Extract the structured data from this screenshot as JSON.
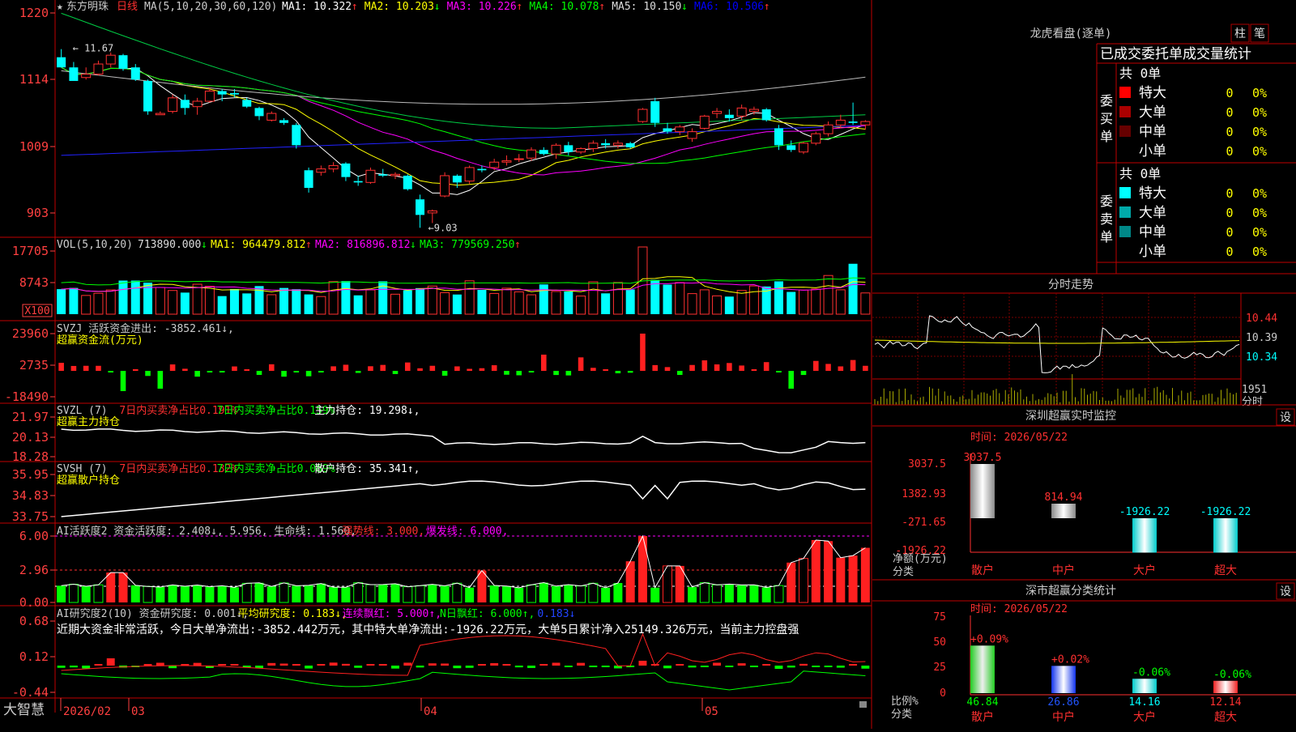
{
  "stock_name": "东方明珠",
  "period_label": "日线",
  "brand": "大智慧",
  "panels": {
    "main": {
      "ma_title": "MA(5,10,20,30,60,120)",
      "indicators": [
        {
          "label": "MA1: 10.322",
          "arrow": "↑",
          "color": "#ffffff"
        },
        {
          "label": "MA2: 10.203",
          "arrow": "↓",
          "color": "#ffff00"
        },
        {
          "label": "MA3: 10.226",
          "arrow": "↑",
          "color": "#ff00ff"
        },
        {
          "label": "MA4: 10.078",
          "arrow": "↑",
          "color": "#00ff00"
        },
        {
          "label": "MA5: 10.150",
          "arrow": "↓",
          "color": "#dddddd"
        },
        {
          "label": "MA6: 10.506",
          "arrow": "↑",
          "color": "#0000ff"
        }
      ],
      "y_labels": [
        "1220",
        "1114",
        "1009",
        "903"
      ],
      "high_mark": "11.67",
      "low_mark": "9.03"
    },
    "vol": {
      "title": "VOL(5,10,20)",
      "indicators": [
        {
          "label": "713890.000",
          "arrow": "↓",
          "color": "#dddddd"
        },
        {
          "label": "MA1: 964479.812",
          "arrow": "↑",
          "color": "#ffff00"
        },
        {
          "label": "MA2: 816896.812",
          "arrow": "↓",
          "color": "#ff00ff"
        },
        {
          "label": "MA3: 779569.250",
          "arrow": "↑",
          "color": "#00ff00"
        }
      ],
      "y_labels": [
        "17705",
        "8743",
        "X100"
      ]
    },
    "svzj": {
      "title": "SVZJ  活跃资金进出: -3852.461↓,",
      "subtitle": "超赢资金流(万元)",
      "y_labels": [
        "23960",
        "2735",
        "-18490"
      ]
    },
    "svzl": {
      "title_parts": [
        "SVZL (7) ",
        "7日内买卖净占比0.191%",
        "7日内买卖净占比0.159%",
        " 主力持仓: 19.298↓,"
      ],
      "subtitle": "超赢主力持仓",
      "y_labels": [
        "21.97",
        "20.13",
        "18.28"
      ]
    },
    "svsh": {
      "title_parts": [
        "SVSH (7) ",
        "7日内买卖净占比0.132%",
        "7日内买卖净占比0.089%",
        " 散户持仓: 35.341↑,"
      ],
      "subtitle": "超赢散户持仓",
      "y_labels": [
        "35.95",
        "34.83",
        "33.75"
      ]
    },
    "ai1": {
      "title_parts": [
        "AI活跃度2 资金活跃度: 2.408↓, 5.956, 生命线: 1.560, ",
        "强势线: 3.000, ",
        "爆发线: 6.000,"
      ],
      "y_labels": [
        "6.00",
        "2.96",
        "0.00"
      ]
    },
    "ai2": {
      "title_parts": [
        "AI研究度2(10) 资金研究度: 0.001↓, ",
        "平均研究度: 0.183↓, ",
        "连续飘红: 5.000↑, ",
        "N日飘红: 6.000↑, ",
        "0.183↓"
      ],
      "note": "近期大资金非常活跃，今日大单净流出:-3852.442万元，其中特大单净流出:-1926.22万元，大单5日累计净入25149.326万元，当前主力控盘强",
      "y_labels": [
        "0.68",
        "0.12",
        "-0.44"
      ]
    }
  },
  "date_axis": [
    "2026/02",
    "03",
    "04",
    "05"
  ],
  "right": {
    "dragon_title": "龙虎看盘(逐单)",
    "tab_zhu": "柱",
    "tab_bi": "笔",
    "stats_header": "已成交委托单成交量统计",
    "buy": {
      "side_label": "委买单",
      "count": "共 0单",
      "rows": [
        {
          "label": "特大",
          "val": "0",
          "pct": "0%",
          "color": "#ff0000"
        },
        {
          "label": "大单",
          "val": "0",
          "pct": "0%",
          "color": "#aa0000"
        },
        {
          "label": "中单",
          "val": "0",
          "pct": "0%",
          "color": "#660000"
        },
        {
          "label": "小单",
          "val": "0",
          "pct": "0%",
          "color": ""
        }
      ]
    },
    "sell": {
      "side_label": "委卖单",
      "count": "共 0单",
      "rows": [
        {
          "label": "特大",
          "val": "0",
          "pct": "0%",
          "color": "#00ffff"
        },
        {
          "label": "大单",
          "val": "0",
          "pct": "0%",
          "color": "#00aaaa"
        },
        {
          "label": "中单",
          "val": "0",
          "pct": "0%",
          "color": "#008888"
        },
        {
          "label": "小单",
          "val": "0",
          "pct": "0%",
          "color": ""
        }
      ]
    },
    "intraday": {
      "title": "分时走势",
      "labels": [
        "10.44",
        "10.39",
        "10.34"
      ],
      "vol_label": "1951",
      "vol_caption": "分时"
    },
    "monitor": {
      "title": "深圳超赢实时监控",
      "setting": "设",
      "time": "时间: 2026/05/22",
      "y_labels": [
        "3037.5",
        "1382.93",
        "-271.65",
        "-1926.22"
      ],
      "axis_caption_1": "净额(万元)",
      "axis_caption_2": "分类",
      "categories": [
        "散户",
        "中户",
        "大户",
        "超大"
      ],
      "values": [
        3037.5,
        814.94,
        -1926.22,
        -1926.22
      ],
      "value_labels": [
        "3037.5",
        "814.94",
        "-1926.22",
        "-1926.22"
      ]
    },
    "classify": {
      "title": "深市超赢分类统计",
      "setting": "设",
      "time": "时间: 2026/05/22",
      "y_labels": [
        "75",
        "50",
        "25",
        "0"
      ],
      "axis_caption_1": "比例%",
      "axis_caption_2": "分类",
      "categories": [
        "散户",
        "中户",
        "大户",
        "超大"
      ],
      "values": [
        46.84,
        26.86,
        14.16,
        12.14
      ],
      "changes": [
        "+0.09%",
        "+0.02%",
        "-0.06%",
        "-0.06%"
      ]
    }
  },
  "chart_data": [
    {
      "type": "candlestick",
      "title": "东方明珠 日线",
      "ylim": [
        9.03,
        12.2
      ],
      "x": [
        "2026/02",
        "03",
        "04",
        "05"
      ],
      "series": [
        {
          "name": "MA1",
          "values": []
        },
        {
          "name": "MA2",
          "values": []
        },
        {
          "name": "MA3",
          "values": []
        },
        {
          "name": "MA4",
          "values": []
        },
        {
          "name": "MA5",
          "values": []
        },
        {
          "name": "MA6",
          "values": []
        }
      ],
      "candles": [
        [
          11.55,
          11.67,
          11.45,
          11.4
        ],
        [
          11.4,
          11.48,
          11.22,
          11.2
        ],
        [
          11.25,
          11.4,
          11.22,
          11.3
        ],
        [
          11.3,
          11.5,
          11.28,
          11.45
        ],
        [
          11.45,
          11.62,
          11.4,
          11.58
        ],
        [
          11.58,
          11.6,
          11.35,
          11.38
        ],
        [
          11.4,
          11.45,
          11.2,
          11.22
        ],
        [
          11.2,
          11.22,
          10.7,
          10.75
        ],
        [
          10.7,
          10.75,
          10.7,
          10.72
        ],
        [
          10.75,
          11.0,
          10.72,
          10.95
        ],
        [
          10.92,
          11.0,
          10.7,
          10.8
        ],
        [
          10.82,
          10.95,
          10.7,
          10.9
        ],
        [
          10.9,
          11.1,
          10.88,
          11.05
        ],
        [
          11.05,
          11.08,
          10.9,
          11.0
        ],
        [
          11.02,
          11.08,
          10.96,
          11.0
        ],
        [
          10.92,
          10.95,
          10.8,
          10.82
        ],
        [
          10.8,
          10.82,
          10.62,
          10.68
        ],
        [
          10.62,
          10.75,
          10.6,
          10.72
        ],
        [
          10.62,
          10.65,
          10.55,
          10.58
        ],
        [
          10.55,
          10.58,
          10.2,
          10.25
        ],
        [
          9.88,
          9.92,
          9.55,
          9.62
        ],
        [
          9.85,
          9.95,
          9.8,
          9.9
        ],
        [
          9.9,
          10.0,
          9.85,
          9.95
        ],
        [
          9.98,
          10.0,
          9.72,
          9.78
        ],
        [
          9.72,
          9.8,
          9.65,
          9.7
        ],
        [
          9.7,
          9.92,
          9.68,
          9.88
        ],
        [
          9.82,
          9.9,
          9.78,
          9.8
        ],
        [
          9.8,
          9.85,
          9.75,
          9.82
        ],
        [
          9.8,
          9.82,
          9.58,
          9.6
        ],
        [
          9.45,
          9.52,
          9.03,
          9.22
        ],
        [
          9.25,
          9.3,
          9.1,
          9.28
        ],
        [
          9.5,
          9.85,
          9.48,
          9.8
        ],
        [
          9.8,
          9.82,
          9.62,
          9.7
        ],
        [
          9.72,
          9.95,
          9.68,
          9.92
        ],
        [
          9.9,
          9.95,
          9.85,
          9.88
        ],
        [
          9.92,
          10.05,
          9.88,
          10.0
        ],
        [
          10.0,
          10.1,
          9.95,
          10.02
        ],
        [
          10.05,
          10.12,
          10.0,
          10.05
        ],
        [
          10.06,
          10.22,
          10.02,
          10.18
        ],
        [
          10.18,
          10.22,
          10.1,
          10.12
        ],
        [
          10.12,
          10.28,
          10.05,
          10.25
        ],
        [
          10.25,
          10.3,
          10.1,
          10.15
        ],
        [
          10.15,
          10.22,
          10.12,
          10.2
        ],
        [
          10.2,
          10.32,
          10.15,
          10.28
        ],
        [
          10.28,
          10.34,
          10.2,
          10.25
        ],
        [
          10.25,
          10.32,
          10.2,
          10.28
        ],
        [
          10.28,
          10.3,
          10.2,
          10.22
        ],
        [
          10.6,
          10.8,
          10.58,
          10.78
        ],
        [
          10.9,
          10.95,
          10.52,
          10.58
        ],
        [
          10.5,
          10.58,
          10.42,
          10.45
        ],
        [
          10.45,
          10.55,
          10.4,
          10.52
        ],
        [
          10.35,
          10.5,
          10.3,
          10.45
        ],
        [
          10.5,
          10.7,
          10.48,
          10.68
        ],
        [
          10.72,
          10.8,
          10.65,
          10.75
        ],
        [
          10.7,
          10.78,
          10.6,
          10.65
        ],
        [
          10.68,
          10.85,
          10.62,
          10.8
        ],
        [
          10.75,
          10.82,
          10.7,
          10.78
        ],
        [
          10.78,
          10.8,
          10.6,
          10.62
        ],
        [
          10.5,
          10.55,
          10.18,
          10.25
        ],
        [
          10.25,
          10.32,
          10.15,
          10.18
        ],
        [
          10.15,
          10.3,
          10.12,
          10.28
        ],
        [
          10.28,
          10.45,
          10.25,
          10.42
        ],
        [
          10.42,
          10.6,
          10.38,
          10.55
        ],
        [
          10.55,
          10.7,
          10.5,
          10.62
        ],
        [
          10.6,
          10.88,
          10.55,
          10.58
        ],
        [
          10.55,
          10.62,
          10.48,
          10.6
        ]
      ]
    }
  ]
}
